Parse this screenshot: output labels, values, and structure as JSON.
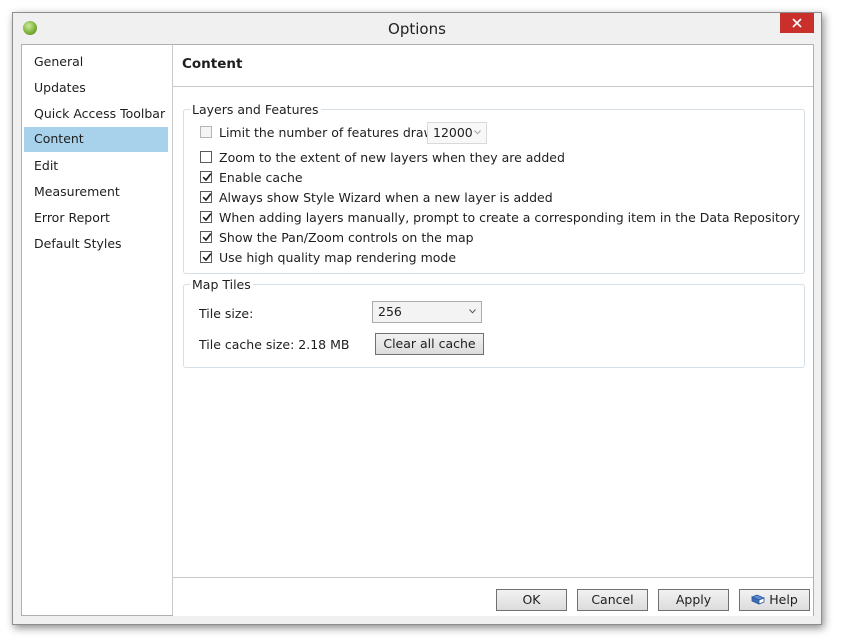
{
  "window": {
    "title": "Options"
  },
  "sidebar": {
    "items": [
      {
        "label": "General"
      },
      {
        "label": "Updates"
      },
      {
        "label": "Quick Access Toolbar"
      },
      {
        "label": "Content"
      },
      {
        "label": "Edit"
      },
      {
        "label": "Measurement"
      },
      {
        "label": "Error Report"
      },
      {
        "label": "Default Styles"
      }
    ],
    "selected": "Content"
  },
  "content": {
    "title": "Content",
    "layers_group": {
      "legend": "Layers and Features",
      "limit_features": {
        "label": "Limit the number of features drawn to:",
        "checked": false,
        "value": "12000"
      },
      "options": [
        {
          "label": "Zoom to the extent of new layers when they are added",
          "checked": false
        },
        {
          "label": "Enable cache",
          "checked": true
        },
        {
          "label": "Always show Style Wizard when a new layer is added",
          "checked": true
        },
        {
          "label": "When adding layers manually, prompt to create a corresponding item in the Data Repository",
          "checked": true
        },
        {
          "label": "Show the Pan/Zoom controls on the map",
          "checked": true
        },
        {
          "label": "Use high quality map rendering mode",
          "checked": true
        }
      ]
    },
    "tiles_group": {
      "legend": "Map Tiles",
      "tile_size_label": "Tile size:",
      "tile_size_value": "256",
      "cache_size_label": "Tile cache size: 2.18 MB",
      "clear_cache_label": "Clear all cache"
    }
  },
  "footer": {
    "ok_label": "OK",
    "cancel_label": "Cancel",
    "apply_label": "Apply",
    "help_label": "Help"
  },
  "colors": {
    "selection": "#a8d2ec",
    "close_button": "#c9302c",
    "window_bg": "#f0f0f0"
  },
  "icons": {
    "app": "app-globe-icon",
    "close": "close-icon",
    "help": "help-book-icon",
    "dropdown": "chevron-down-icon",
    "check": "checkmark-icon"
  }
}
